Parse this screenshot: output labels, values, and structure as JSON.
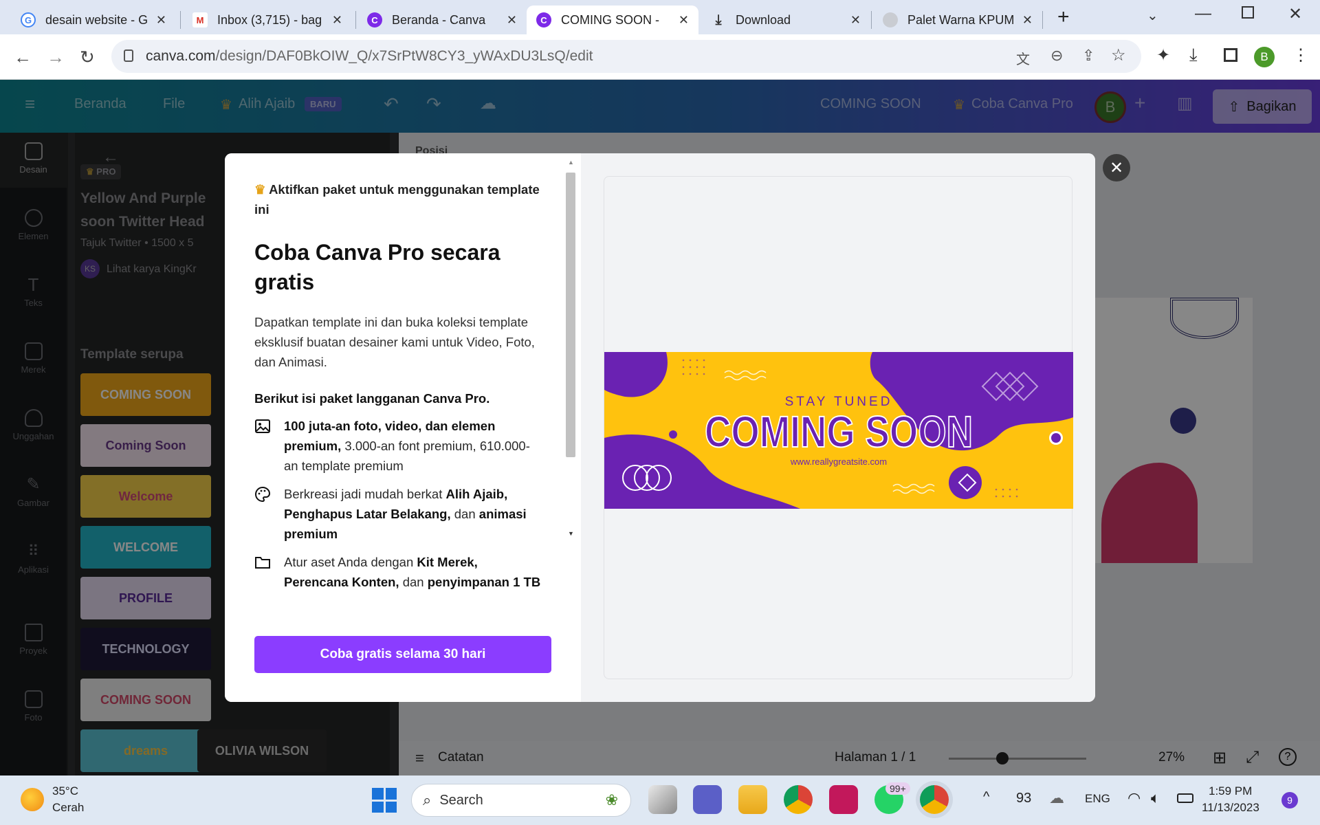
{
  "browser": {
    "tabs": [
      {
        "title": "desain website - G",
        "favicon": "google-icon"
      },
      {
        "title": "Inbox (3,715) - bag",
        "favicon": "gmail-icon"
      },
      {
        "title": "Beranda - Canva",
        "favicon": "canva-icon"
      },
      {
        "title": "COMING SOON - ",
        "favicon": "canva-icon",
        "active": true
      },
      {
        "title": "Download",
        "favicon": "download-icon"
      },
      {
        "title": "Palet Warna KPUM",
        "favicon": "globe-icon"
      }
    ],
    "url_host": "canva.com",
    "url_path": "/design/DAF0BkOIW_Q/x7SrPtW8CY3_yWAxDU3LsQ/edit",
    "profile_initial": "B"
  },
  "canva_header": {
    "home": "Beranda",
    "file": "File",
    "magic": "Alih Ajaib",
    "magic_badge": "BARU",
    "doc_title": "COMING SOON",
    "try_pro": "Coba Canva Pro",
    "avatar": "B",
    "share": "Bagikan"
  },
  "sidebar": {
    "items": [
      {
        "label": "Desain"
      },
      {
        "label": "Elemen"
      },
      {
        "label": "Teks"
      },
      {
        "label": "Merek"
      },
      {
        "label": "Unggahan"
      },
      {
        "label": "Gambar"
      },
      {
        "label": "Aplikasi"
      },
      {
        "label": "Proyek"
      },
      {
        "label": "Foto"
      }
    ]
  },
  "panel": {
    "pro_badge": "PRO",
    "title_line1": "Yellow And Purple",
    "title_line2": "soon Twitter Head",
    "meta": "Tajuk Twitter • 1500 x 5",
    "author_initials": "KS",
    "author_text": "Lihat karya KingKr",
    "similar_heading": "Template serupa",
    "thumbs": [
      {
        "text": "COMING SOON",
        "bg": "#f2a81a",
        "fg": "#ffffff"
      },
      {
        "text": "Coming Soon",
        "bg": "#f7e7f1",
        "fg": "#6b3a8a"
      },
      {
        "text": "Welcome",
        "bg": "#f7d24a",
        "fg": "#d44a7a"
      },
      {
        "text": "WELCOME",
        "bg": "#22b6c8",
        "fg": "#ffffff"
      },
      {
        "text": "PROFILE",
        "bg": "#e8def4",
        "fg": "#5a2a9a"
      },
      {
        "text": "TECHNOLOGY",
        "bg": "#1f1a3a",
        "fg": "#e0e0ff"
      },
      {
        "text": "COMING SOON",
        "bg": "#f0f0f0",
        "fg": "#d34a6a"
      },
      {
        "text": "dreams",
        "bg": "#5cc4d6",
        "fg": "#f7c84a"
      },
      {
        "text": "OLIVIA WILSON",
        "bg": "#2a2a2a",
        "fg": "#c8c8c8"
      }
    ]
  },
  "canvas": {
    "page_label": "Posisi",
    "notes": "Catatan",
    "page_indicator": "Halaman 1 / 1",
    "zoom": "27%",
    "zoom_fraction": 0.27
  },
  "modal": {
    "kicker": "Aktifkan paket untuk menggunakan template ini",
    "heading_line1": "Coba Canva Pro secara",
    "heading_line2": "gratis",
    "description": "Dapatkan template ini dan buka koleksi template eksklusif buatan desainer kami untuk Video, Foto, dan Animasi.",
    "features_heading": "Berikut isi paket langganan Canva Pro.",
    "features": [
      {
        "bold": "100 juta-an foto, video, dan elemen premium,",
        "rest": " 3.000-an font premium, 610.000-an template premium"
      },
      {
        "pre": "Berkreasi jadi mudah berkat ",
        "bold1": "Alih Ajaib, Penghapus Latar Belakang,",
        "mid": " dan ",
        "bold2": "animasi premium"
      },
      {
        "pre": "Atur aset Anda dengan ",
        "bold1": "Kit Merek, Perencana Konten,",
        "mid": " dan ",
        "bold2": "penyimpanan 1 TB"
      }
    ],
    "cta": "Coba gratis selama 30 hari",
    "preview": {
      "small_heading": "STAY TUNED",
      "main_heading": "COMING SOON",
      "url": "www.reallygreatsite.com",
      "colors": {
        "yellow": "#ffc20e",
        "purple": "#6a22b2"
      }
    }
  },
  "taskbar": {
    "weather_temp": "35°C",
    "weather_desc": "Cerah",
    "search": "Search",
    "whatsapp_badge": "99+",
    "battery": "93",
    "lang": "ENG",
    "time": "1:59 PM",
    "date": "11/13/2023",
    "notif_count": "9"
  }
}
